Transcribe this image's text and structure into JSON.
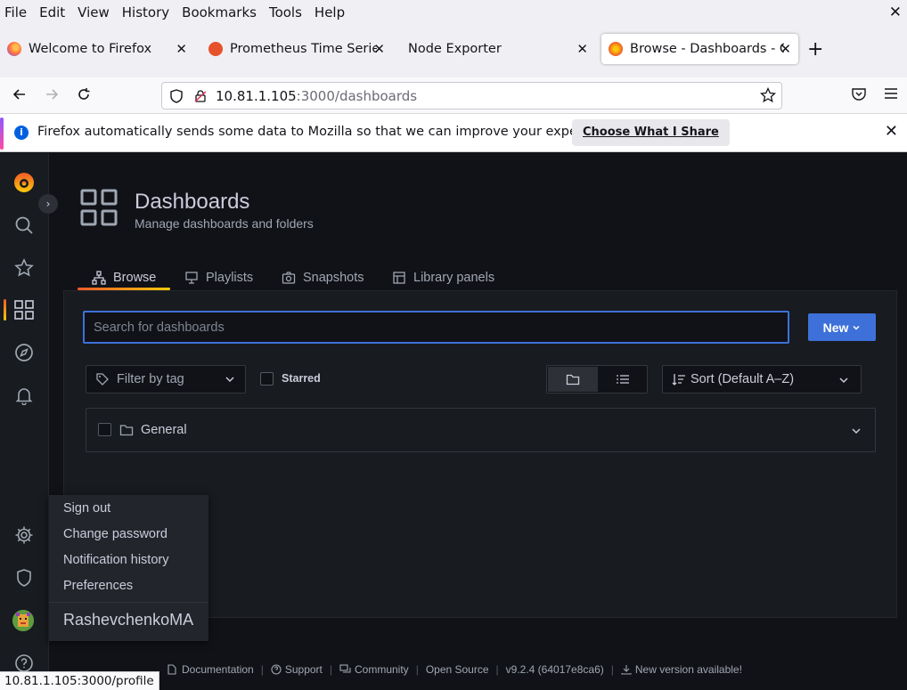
{
  "browser": {
    "menu": [
      "File",
      "Edit",
      "View",
      "History",
      "Bookmarks",
      "Tools",
      "Help"
    ],
    "tabs": [
      {
        "title": "Welcome to Firefox",
        "icon": "firefox-icon"
      },
      {
        "title": "Prometheus Time Series C",
        "icon": "prometheus-icon"
      },
      {
        "title": "Node Exporter",
        "icon": ""
      },
      {
        "title": "Browse - Dashboards - Gr",
        "icon": "grafana-icon"
      }
    ],
    "url_host": "10.81.1.105",
    "url_path": ":3000/dashboards",
    "notification": {
      "text": "Firefox automatically sends some data to Mozilla so that we can improve your experience.",
      "button": "Choose What I Share"
    },
    "status_url": "10.81.1.105:3000/profile"
  },
  "page": {
    "title": "Dashboards",
    "subtitle": "Manage dashboards and folders",
    "tabs": [
      "Browse",
      "Playlists",
      "Snapshots",
      "Library panels"
    ],
    "search_placeholder": "Search for dashboards",
    "new_button": "New",
    "filter_placeholder": "Filter by tag",
    "starred_label": "Starred",
    "sort_label": "Sort (Default A–Z)",
    "folders": [
      {
        "name": "General"
      }
    ]
  },
  "profile_menu": {
    "items": [
      "Sign out",
      "Change password",
      "Notification history",
      "Preferences"
    ],
    "user": "RashevchenkoMA"
  },
  "footer": [
    "Documentation",
    "Support",
    "Community",
    "Open Source",
    "v9.2.4 (64017e8ca6)",
    "New version available!"
  ],
  "colors": {
    "accent": "#3d71d9",
    "gradient_start": "#f05a28",
    "gradient_end": "#fbca0a",
    "background": "#111217"
  }
}
